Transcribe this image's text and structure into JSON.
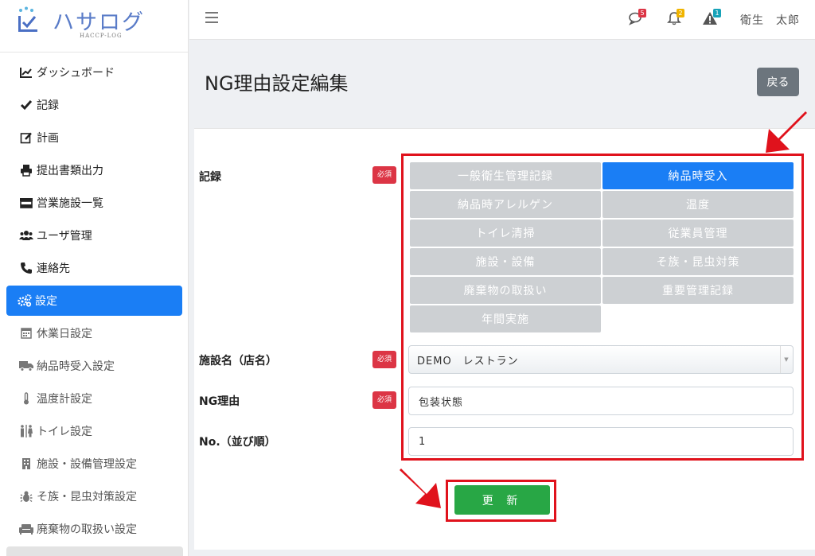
{
  "logo": {
    "text": "ハサログ",
    "sub": "HACCP-LOG"
  },
  "sidebar": {
    "items": [
      {
        "label": "ダッシュボード",
        "icon": "chart-line-icon"
      },
      {
        "label": "記録",
        "icon": "check-icon"
      },
      {
        "label": "計画",
        "icon": "edit-icon"
      },
      {
        "label": "提出書類出力",
        "icon": "printer-icon"
      },
      {
        "label": "営業施設一覧",
        "icon": "store-icon"
      },
      {
        "label": "ユーザ管理",
        "icon": "users-icon"
      },
      {
        "label": "連絡先",
        "icon": "phone-icon"
      },
      {
        "label": "設定",
        "icon": "cogs-icon",
        "active": true
      },
      {
        "label": "休業日設定",
        "icon": "calendar-icon"
      },
      {
        "label": "納品時受入設定",
        "icon": "truck-icon"
      },
      {
        "label": "温度計設定",
        "icon": "thermometer-icon"
      },
      {
        "label": "トイレ設定",
        "icon": "restroom-icon"
      },
      {
        "label": "施設・設備管理設定",
        "icon": "building-icon"
      },
      {
        "label": "そ族・昆虫対策設定",
        "icon": "bug-icon"
      },
      {
        "label": "廃棄物の取扱い設定",
        "icon": "couch-icon"
      }
    ]
  },
  "topbar": {
    "messages_count": "5",
    "notifications_count": "2",
    "alerts_count": "1",
    "user_name": "衛生　太郎",
    "colors": {
      "messages": "#dc3545",
      "notifications": "#f0b400",
      "alerts": "#17a2b8"
    }
  },
  "page": {
    "title": "NG理由設定編集",
    "back_label": "戻る"
  },
  "form": {
    "required_label": "必須",
    "record_label": "記録",
    "facility_label": "施設名（店名）",
    "reason_label": "NG理由",
    "order_label": "No.（並び順）",
    "categories": [
      {
        "label": "一般衛生管理記録",
        "active": false
      },
      {
        "label": "納品時受入",
        "active": true
      },
      {
        "label": "納品時アレルゲン",
        "active": false
      },
      {
        "label": "温度",
        "active": false
      },
      {
        "label": "トイレ清掃",
        "active": false
      },
      {
        "label": "従業員管理",
        "active": false
      },
      {
        "label": "施設・設備",
        "active": false
      },
      {
        "label": "そ族・昆虫対策",
        "active": false
      },
      {
        "label": "廃棄物の取扱い",
        "active": false
      },
      {
        "label": "重要管理記録",
        "active": false
      },
      {
        "label": "年間実施",
        "active": false
      }
    ],
    "facility_value": "DEMO　レストラン",
    "reason_value": "包装状態",
    "order_value": "1",
    "update_label": "更 新"
  }
}
